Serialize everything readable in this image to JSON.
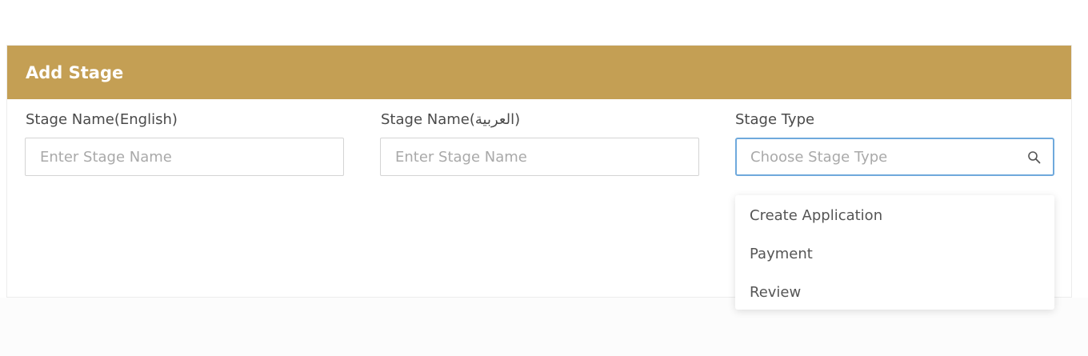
{
  "form": {
    "title": "Add Stage",
    "header_color": "#c49f54",
    "fields": {
      "name_en": {
        "label": "Stage Name(English)",
        "placeholder": "Enter Stage Name",
        "value": ""
      },
      "name_ar": {
        "label": "Stage Name(العربية)",
        "placeholder": "Enter Stage Name",
        "value": ""
      },
      "stage_type": {
        "label": "Stage Type",
        "placeholder": "Choose Stage Type",
        "icon": "search-icon",
        "focus_color": "#6fa9dc",
        "options": [
          "Create Application",
          "Payment",
          "Review"
        ]
      }
    }
  }
}
